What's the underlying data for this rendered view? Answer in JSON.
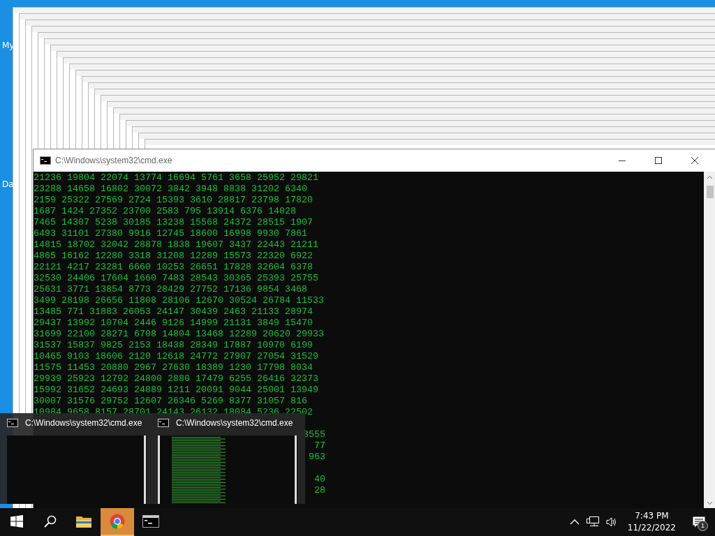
{
  "desktop": {
    "icon_labels": [
      "My",
      "Da"
    ]
  },
  "console": {
    "title": "C:\\Windows\\system32\\cmd.exe",
    "lines": [
      "21236 19804 22074 13774 16694 5761 3658 25952 29821",
      "23288 14658 16802 30072 3842 3948 8838 31202 6340",
      "2159 25322 27569 2724 15393 3610 28817 23798 17820",
      "1687 1424 27352 23700 2583 795 13914 6376 14028",
      "7465 14307 5238 30185 13238 15568 24372 28515 1907",
      "6493 31101 27380 9916 12745 18600 16998 9930 7861",
      "14815 18702 32042 28878 1838 19607 3437 22443 21211",
      "4865 16162 12280 3318 31208 12289 15573 22320 6922",
      "22121 4217 23281 6660 10253 26651 17828 32604 6378",
      "32530 24406 17604 1660 7483 28543 30365 25393 25755",
      "25631 3771 13854 8773 28429 27752 17136 9854 3468",
      "3499 28198 26656 11808 28106 12670 30524 26784 11533",
      "13485 771 31883 26053 24147 30439 2463 21133 28974",
      "29437 13992 10704 2446 9126 14999 21131 3849 15470",
      "31699 22100 28271 6708 14804 13468 12289 20620 29933",
      "31537 15837 9825 2153 18438 28349 17887 10970 6199",
      "10465 9103 18606 2120 12618 24772 27907 27054 31529",
      "11575 11453 20880 2967 27630 18389 1230 17798 8034",
      "29939 25923 12792 24800 2880 17479 6255 26416 32373",
      "15992 31652 24693 24889 1211 20091 9044 25001 13949",
      "30007 31576 29752 12607 26346 5269 8377 31057 816",
      "10984 9658 8157 28701 24143 26132 18084 5236 22502"
    ],
    "covered_line_tails": [
      {
        "kind": "gap"
      },
      {
        "kind": "tail",
        "text": "3555"
      },
      {
        "kind": "tail",
        "text": "77"
      },
      {
        "kind": "tail",
        "text": "963"
      },
      {
        "kind": "gap"
      },
      {
        "kind": "tail",
        "text": "40"
      },
      {
        "kind": "tail",
        "text": "28"
      }
    ]
  },
  "thumbnail_popup": {
    "items": [
      {
        "title": "C:\\Windows\\system32\\cmd.exe",
        "kind": "blank"
      },
      {
        "title": "C:\\Windows\\system32\\cmd.exe",
        "kind": "text"
      }
    ]
  },
  "taskbar": {
    "items": [
      {
        "kind": "start",
        "highlighted": false
      },
      {
        "kind": "search",
        "highlighted": false
      },
      {
        "kind": "folder",
        "highlighted": false
      },
      {
        "kind": "browser",
        "highlighted": true
      },
      {
        "kind": "console",
        "highlighted": false
      }
    ],
    "clock": {
      "time": "7:43 PM",
      "date": "11/22/2022"
    },
    "notification_count": "1"
  }
}
